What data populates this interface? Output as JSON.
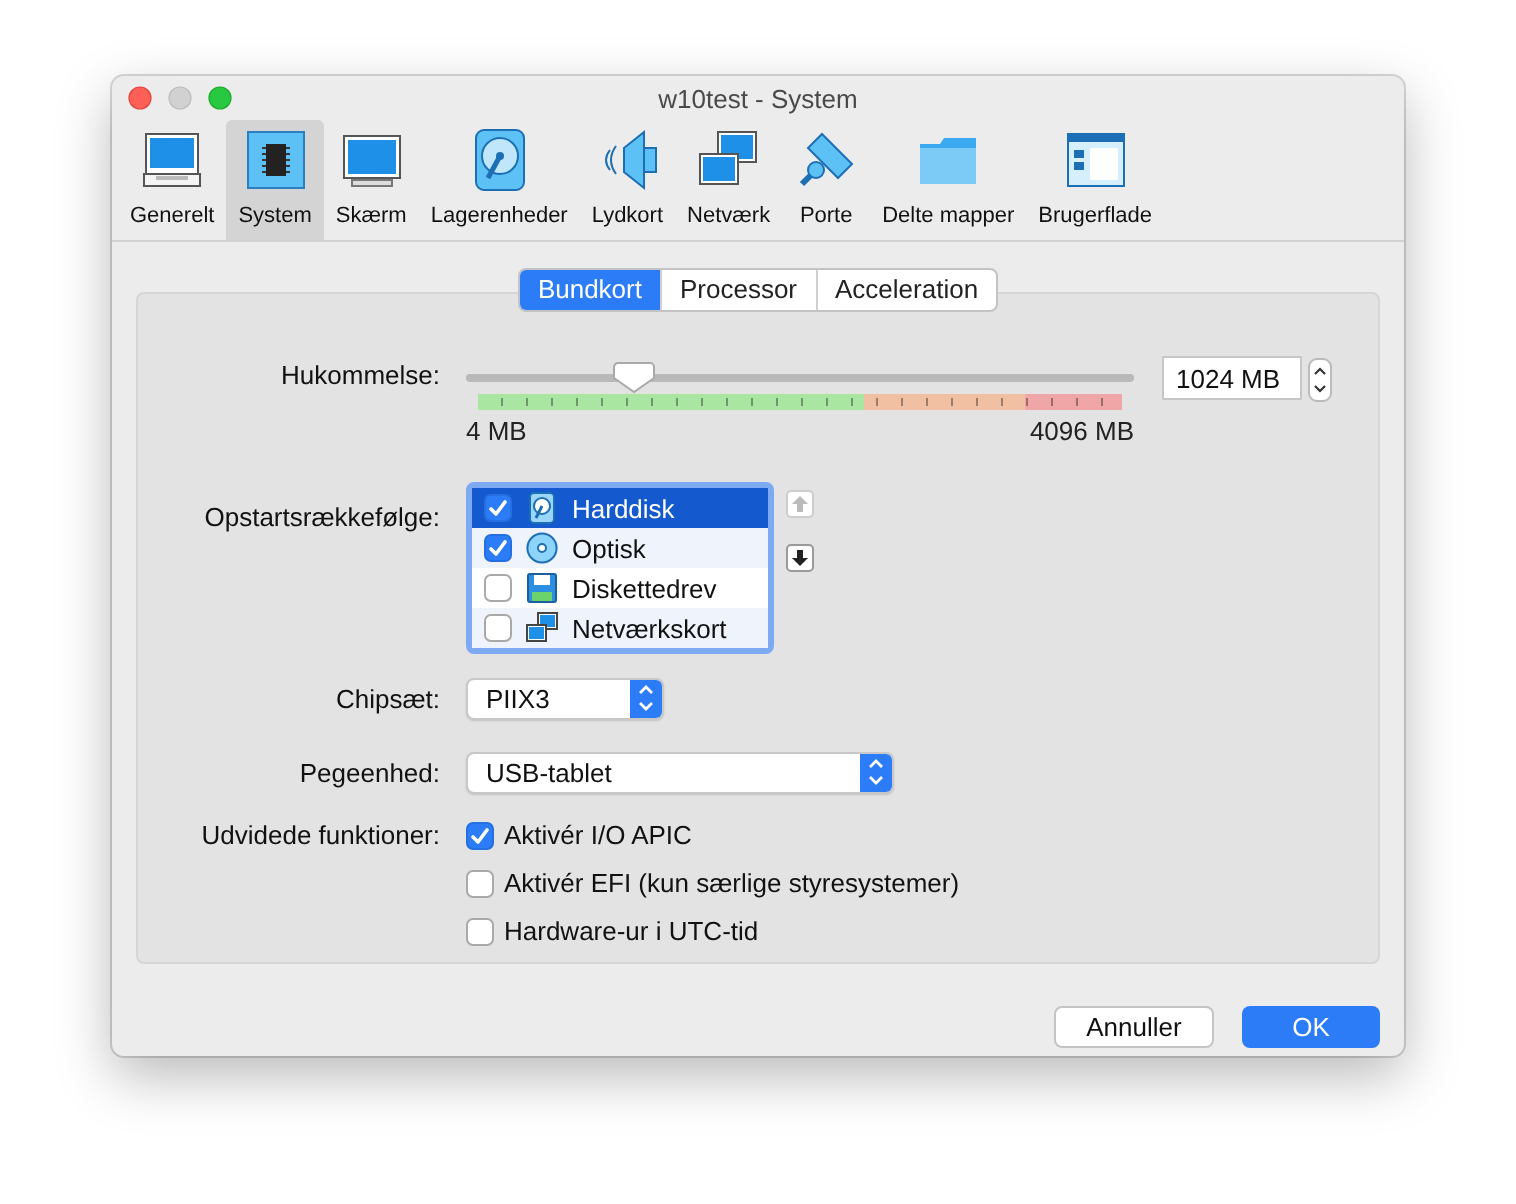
{
  "window": {
    "title": "w10test - System"
  },
  "toolbar": [
    {
      "label": "Generelt",
      "kind": "general",
      "selected": false
    },
    {
      "label": "System",
      "kind": "system",
      "selected": true
    },
    {
      "label": "Skærm",
      "kind": "display",
      "selected": false
    },
    {
      "label": "Lagerenheder",
      "kind": "storage",
      "selected": false
    },
    {
      "label": "Lydkort",
      "kind": "audio",
      "selected": false
    },
    {
      "label": "Netværk",
      "kind": "network",
      "selected": false
    },
    {
      "label": "Porte",
      "kind": "ports",
      "selected": false
    },
    {
      "label": "Delte mapper",
      "kind": "shared",
      "selected": false
    },
    {
      "label": "Brugerflade",
      "kind": "ui",
      "selected": false
    }
  ],
  "tabs": [
    {
      "label": "Bundkort",
      "selected": true
    },
    {
      "label": "Processor",
      "selected": false
    },
    {
      "label": "Acceleration",
      "selected": false
    }
  ],
  "memory": {
    "label": "Hukommelse:",
    "level": 0.25,
    "min_label": "4 MB",
    "max_label": "4096 MB",
    "value": "1024 MB"
  },
  "boot_order": {
    "label": "Opstartsrækkefølge:",
    "items": [
      {
        "label": "Harddisk",
        "kind": "harddisk",
        "checked": true,
        "selected": true
      },
      {
        "label": "Optisk",
        "kind": "optical",
        "checked": true,
        "selected": false
      },
      {
        "label": "Diskettedrev",
        "kind": "floppy",
        "checked": false,
        "selected": false
      },
      {
        "label": "Netværkskort",
        "kind": "network",
        "checked": false,
        "selected": false
      }
    ],
    "move_up": {
      "disabled": true
    },
    "move_down": {
      "disabled": false
    }
  },
  "chipset": {
    "label": "Chipsæt:",
    "value": "PIIX3"
  },
  "pointing_device": {
    "label": "Pegeenhed:",
    "value": "USB-tablet"
  },
  "extended_features": {
    "label": "Udvidede funktioner:",
    "options": [
      {
        "label": "Aktivér I/O APIC",
        "checked": true
      },
      {
        "label": "Aktivér EFI (kun særlige styresystemer)",
        "checked": false
      },
      {
        "label": "Hardware-ur i UTC-tid",
        "checked": false
      }
    ]
  },
  "buttons": [
    {
      "label": "Annuller",
      "kind": "cancel"
    },
    {
      "label": "OK",
      "kind": "default"
    }
  ]
}
